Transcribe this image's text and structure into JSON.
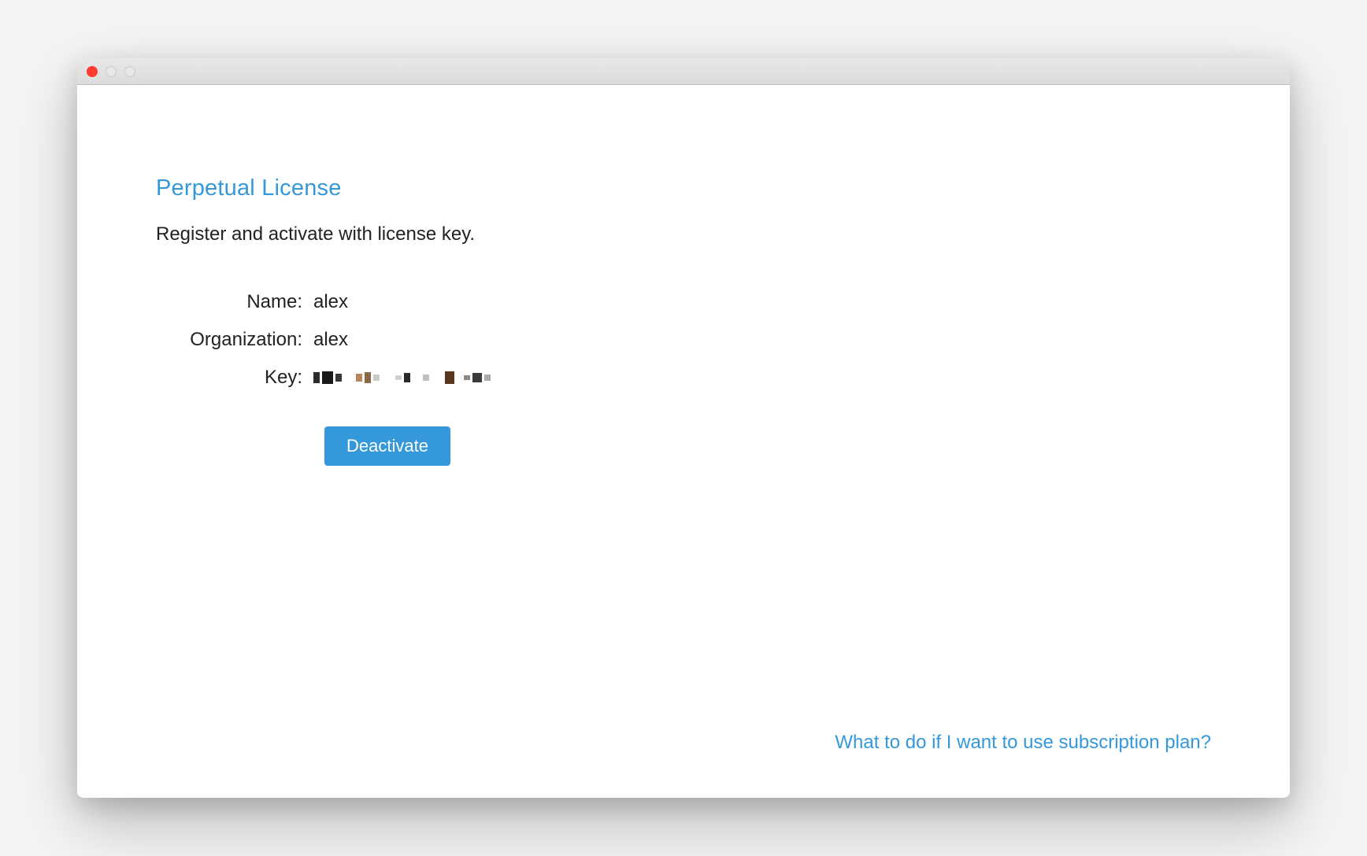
{
  "window": {
    "title": ""
  },
  "license": {
    "heading": "Perpetual License",
    "subtitle": "Register and activate with license key.",
    "fields": {
      "name_label": "Name:",
      "name_value": "alex",
      "organization_label": "Organization:",
      "organization_value": "alex",
      "key_label": "Key:",
      "key_value_obscured": true
    },
    "deactivate_label": "Deactivate"
  },
  "footer": {
    "subscription_link": "What to do if I want to use subscription plan?"
  },
  "colors": {
    "accent": "#3498db",
    "text": "#222222"
  }
}
